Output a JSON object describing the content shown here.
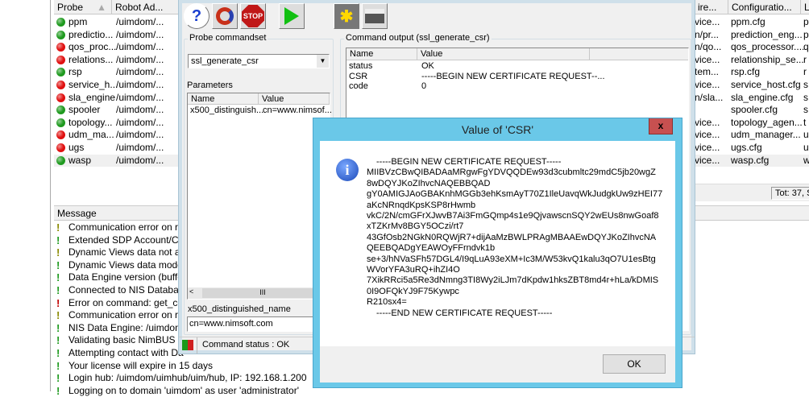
{
  "probe_list": {
    "columns": [
      "Probe",
      "Robot Ad..."
    ],
    "rows": [
      {
        "name": "ppm",
        "robot": "/uimdom/...",
        "status": "green"
      },
      {
        "name": "predictio...",
        "robot": "/uimdom/...",
        "status": "green"
      },
      {
        "name": "qos_proc...",
        "robot": "/uimdom/...",
        "status": "red"
      },
      {
        "name": "relations...",
        "robot": "/uimdom/...",
        "status": "red"
      },
      {
        "name": "rsp",
        "robot": "/uimdom/...",
        "status": "green"
      },
      {
        "name": "service_h...",
        "robot": "/uimdom/...",
        "status": "red"
      },
      {
        "name": "sla_engine",
        "robot": "/uimdom/...",
        "status": "red"
      },
      {
        "name": "spooler",
        "robot": "/uimdom/...",
        "status": "green"
      },
      {
        "name": "topology...",
        "robot": "/uimdom/...",
        "status": "green"
      },
      {
        "name": "udm_ma...",
        "robot": "/uimdom/...",
        "status": "red"
      },
      {
        "name": "ugs",
        "robot": "/uimdom/...",
        "status": "red"
      },
      {
        "name": "wasp",
        "robot": "/uimdom/...",
        "status": "green"
      }
    ]
  },
  "right_list": {
    "columns": [
      "ire...",
      "Configuratio...",
      "L"
    ],
    "rows": [
      [
        "vice...",
        "ppm.cfg",
        "p"
      ],
      [
        "n/pr...",
        "prediction_eng...",
        "p"
      ],
      [
        "n/qo...",
        "qos_processor....",
        "q"
      ],
      [
        "vice...",
        "relationship_se...",
        "r"
      ],
      [
        "tem...",
        "rsp.cfg",
        "r"
      ],
      [
        "vice...",
        "service_host.cfg",
        "s"
      ],
      [
        "n/sla...",
        "sla_engine.cfg",
        "s"
      ],
      [
        "",
        "spooler.cfg",
        "s"
      ],
      [
        "vice...",
        "topology_agen...",
        "t"
      ],
      [
        "vice...",
        "udm_manager...",
        "u"
      ],
      [
        "vice...",
        "ugs.cfg",
        "u"
      ],
      [
        "vice...",
        "wasp.cfg",
        "w"
      ]
    ],
    "total": "Tot: 37, S"
  },
  "messages": {
    "header": "Message",
    "rows": [
      {
        "text": "Communication error on re",
        "level": "warn"
      },
      {
        "text": "Extended SDP Account/Con",
        "level": "ok"
      },
      {
        "text": "Dynamic Views data not ava",
        "level": "warn"
      },
      {
        "text": "Dynamic Views data model",
        "level": "ok"
      },
      {
        "text": "Data Engine version (buffer",
        "level": "ok"
      },
      {
        "text": "Connected to NIS Database",
        "level": "ok"
      },
      {
        "text": "Error on command: get_cor",
        "level": "error"
      },
      {
        "text": "Communication error on re",
        "level": "warn"
      },
      {
        "text": "NIS Data Engine: /uimdom/",
        "level": "ok"
      },
      {
        "text": "Validating basic NimBUS pe",
        "level": "ok"
      },
      {
        "text": "Attempting contact with Da",
        "level": "ok"
      },
      {
        "text": "Your license will expire in 15 days",
        "level": "ok"
      },
      {
        "text": "Login hub: /uimdom/uimhub/uim/hub, IP: 192.168.1.200",
        "level": "ok"
      },
      {
        "text": "Logging on to domain 'uimdom' as user 'administrator'",
        "level": "ok"
      }
    ]
  },
  "probe_utility": {
    "toolbar": {
      "help": "?",
      "stop": "STOP"
    },
    "commandset_label": "Probe commandset",
    "commandset_value": "ssl_generate_csr",
    "parameters_label": "Parameters",
    "param_columns": [
      "Name",
      "Value"
    ],
    "param_rows": [
      [
        "x500_distinguish...",
        "cn=www.nimsof..."
      ]
    ],
    "scroll_thumb": "III",
    "selected_param_name": "x500_distinguished_name",
    "selected_param_value": "cn=www.nimsoft.com",
    "output_label": "Command output (ssl_generate_csr)",
    "output_columns": [
      "Name",
      "Value"
    ],
    "output_rows": [
      [
        "status",
        "OK"
      ],
      [
        "CSR",
        "-----BEGIN NEW CERTIFICATE REQUEST--..."
      ],
      [
        "code",
        "0"
      ]
    ],
    "status_text": "Command status : OK"
  },
  "dialog": {
    "title": "Value of 'CSR'",
    "close": "x",
    "lines": [
      "-----BEGIN NEW CERTIFICATE REQUEST-----",
      "MIIBVzCBwQIBADAaMRgwFgYDVQQDEw93d3cubmltc29mdC5jb20wgZ",
      "8wDQYJKoZIhvcNAQEBBQAD",
      "gY0AMIGJAoGBAKnhMGGb3ehKsmAyT70Z1IleUavqWkJudgkUw9zHEI77",
      "aKcNRnqdKpsKSP8rHwmb",
      "vkC/2N/cmGFrXJwvB7Ai3FmGQmp4s1e9QjvawscnSQY2wEUs8nwGoaf8",
      "xTZKrMv8BGY5OCzi/rt7",
      "43GfOsb2NGkN0RQWjR7+dijAaMzBWLPRAgMBAAEwDQYJKoZIhvcNA",
      "QEEBQADgYEAWOyFFrndvk1b",
      "se+3/hNVaSFh57DGL4/I9qLuA93eXM+Ic3M/W53kvQ1kalu3qO7U1esBtg",
      "WVorYFA3uRQ+ihZI4O",
      "7XikRRci5a5Re3dNmng3TI8Wy2iLJm7dKpdw1hksZBT8md4r+hLa/kDMIS",
      "0I9OFQkYJ9F75Kywpc",
      "R210sx4=",
      "-----END NEW CERTIFICATE REQUEST-----"
    ],
    "ok_label": "OK"
  },
  "colors": {
    "green": "#1f9a1f",
    "red": "#e01010",
    "warn": "#8a8a00",
    "ok": "#1f9a1f",
    "error": "#c00000",
    "dialog_frame": "#6ac8e8",
    "close_btn": "#c75050"
  }
}
